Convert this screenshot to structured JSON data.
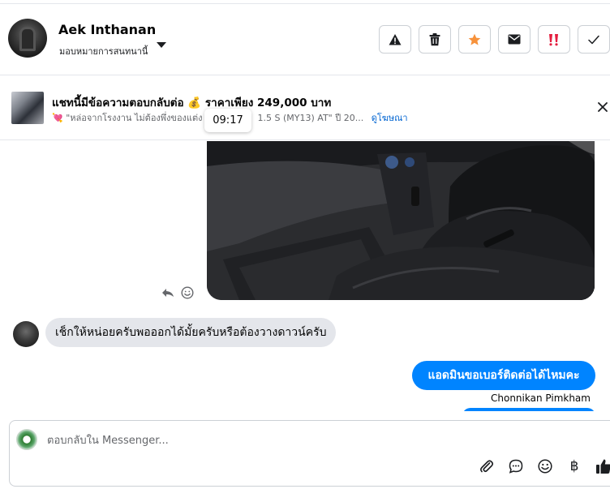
{
  "header": {
    "user_name": "Aek Inthanan",
    "assign_label": "มอบหมายการสนทนานี้",
    "actions": [
      {
        "name": "report-icon"
      },
      {
        "name": "trash-icon"
      },
      {
        "name": "star-icon"
      },
      {
        "name": "envelope-icon"
      },
      {
        "name": "spam-icon"
      },
      {
        "name": "check-icon"
      }
    ]
  },
  "promo": {
    "title": "แชทนี้มีข้อความตอบกลับต่อ 💰 ราคาเพียง 249,000 บาท",
    "subtitle_left": "\"หล่อจากโรงงาน ไม่ต้องพึ่งของแต่ง",
    "subtitle_right": "1.5 S (MY13) AT\" ปี 20...",
    "link": "ดูโฆษณา"
  },
  "tooltip": {
    "time": "09:17"
  },
  "messages": [
    {
      "direction": "incoming",
      "text": "เช็กให้หน่อยครับพอออกได้มั้ยครับหรือต้องวางดาวน์ครับ"
    },
    {
      "direction": "outgoing",
      "text": "แอดมินขอเบอร์ติดต่อได้ไหมคะ",
      "sender": "Chonnikan Pimkham"
    }
  ],
  "composer": {
    "placeholder": "ตอบกลับใน Messenger...",
    "tools": [
      "paperclip-icon",
      "chat-bubble-icon",
      "emoji-icon",
      "baht-icon",
      "thumbs-up-icon"
    ],
    "baht_symbol": "฿"
  },
  "colors": {
    "brand_blue": "#0084ff",
    "link_blue": "#0064d1",
    "star_orange": "#f7923b",
    "spam_red": "#e41e3f"
  }
}
